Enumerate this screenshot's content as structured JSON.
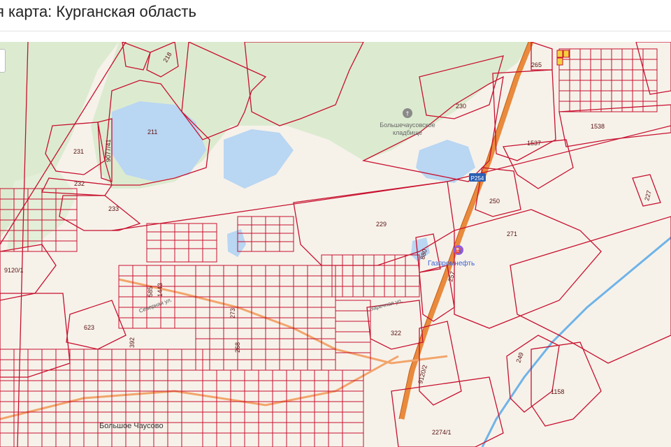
{
  "header": {
    "title": "я карта: Курганская область"
  },
  "map": {
    "road_shield": "P254",
    "poi": [
      {
        "name": "Большечаусовское кладбище",
        "icon": "cemetery-icon",
        "line1": "Большечаусовское",
        "line2": "кладбище"
      },
      {
        "name": "Газпромнефть",
        "icon": "fuel-station-icon"
      }
    ],
    "settlement": "Большое Чаусово",
    "streets": [
      "Северная ул.",
      "Заречная ул."
    ],
    "parcels": [
      "218",
      "211",
      "231",
      "9077/41",
      "232",
      "233",
      "9120/1",
      "623",
      "392",
      "585",
      "1443",
      "273",
      "268",
      "230",
      "1538",
      "1537",
      "265",
      "250",
      "227",
      "229",
      "271",
      "880",
      "257",
      "322",
      "9120/2",
      "249",
      "1158",
      "2274/1"
    ],
    "colors": {
      "parcel": "#c8102e",
      "forest": "#dcebd0",
      "water": "#b9d6f2",
      "road": "#e98a3c",
      "ground": "#f6f2ea"
    }
  }
}
